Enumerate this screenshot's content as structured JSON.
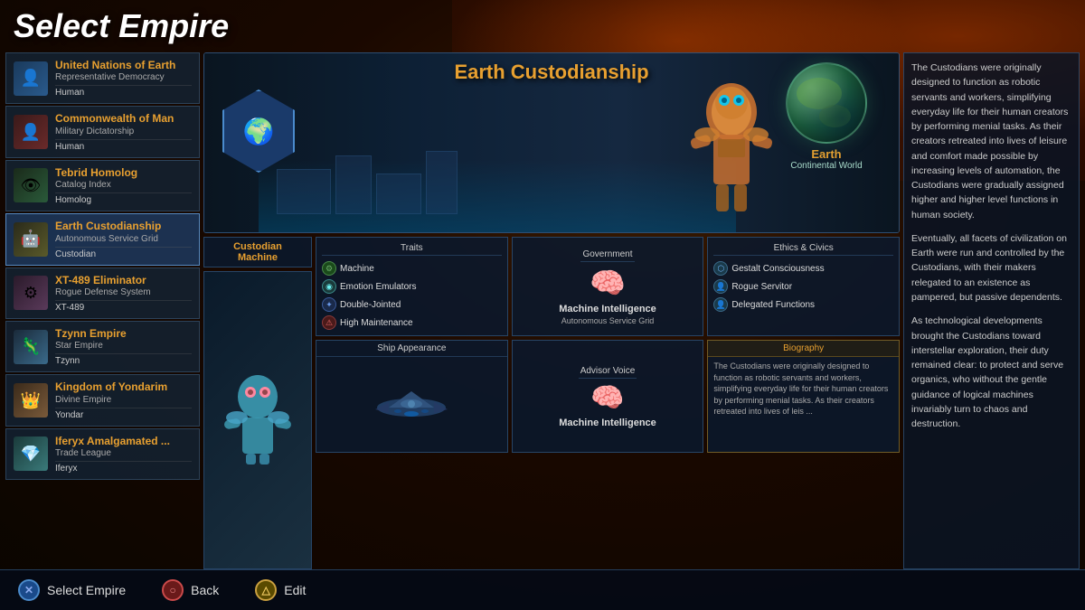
{
  "header": {
    "title": "Select Empire"
  },
  "empires": [
    {
      "id": "ue",
      "name": "United Nations of Earth",
      "government": "Representative Democracy",
      "species": "Human",
      "avatar": "👤",
      "avatarClass": "avatar-ue",
      "selected": false
    },
    {
      "id": "cm",
      "name": "Commonwealth of Man",
      "government": "Military Dictatorship",
      "species": "Human",
      "avatar": "👤",
      "avatarClass": "avatar-cm",
      "selected": false
    },
    {
      "id": "th",
      "name": "Tebrid Homolog",
      "government": "Catalog Index",
      "species": "Homolog",
      "avatar": "👁",
      "avatarClass": "avatar-th",
      "selected": false
    },
    {
      "id": "ec",
      "name": "Earth Custodianship",
      "government": "Autonomous Service Grid",
      "species": "Custodian",
      "avatar": "🤖",
      "avatarClass": "avatar-ec",
      "selected": true
    },
    {
      "id": "xt",
      "name": "XT-489 Eliminator",
      "government": "Rogue Defense System",
      "species": "XT-489",
      "avatar": "⚙",
      "avatarClass": "avatar-xt",
      "selected": false
    },
    {
      "id": "tz",
      "name": "Tzynn Empire",
      "government": "Star Empire",
      "species": "Tzynn",
      "avatar": "🦎",
      "avatarClass": "avatar-tz",
      "selected": false
    },
    {
      "id": "ky",
      "name": "Kingdom of Yondarim",
      "government": "Divine Empire",
      "species": "Yondar",
      "avatar": "👑",
      "avatarClass": "avatar-ky",
      "selected": false
    },
    {
      "id": "ia",
      "name": "Iferyx Amalgamated ...",
      "government": "Trade League",
      "species": "Iferyx",
      "avatar": "💎",
      "avatarClass": "avatar-ia",
      "selected": false
    }
  ],
  "selected_empire": {
    "name": "Earth Custodianship",
    "planet": {
      "name": "Earth",
      "type": "Continental World"
    },
    "portrait_label_line1": "Custodian",
    "portrait_label_line2": "Machine",
    "traits_header": "Traits",
    "traits": [
      {
        "name": "Machine",
        "iconClass": "green",
        "icon": "⚙"
      },
      {
        "name": "Emotion Emulators",
        "iconClass": "teal",
        "icon": "◉"
      },
      {
        "name": "Double-Jointed",
        "iconClass": "blue",
        "icon": "✦"
      },
      {
        "name": "High Maintenance",
        "iconClass": "red",
        "icon": "⚠"
      }
    ],
    "government_header": "Government",
    "government": {
      "name": "Machine Intelligence",
      "sub": "Autonomous Service Grid",
      "icon": "🧠"
    },
    "ethics_header": "Ethics & Civics",
    "ethics": [
      {
        "name": "Gestalt Consciousness",
        "icon": "⬡"
      },
      {
        "name": "Rogue Servitor",
        "icon": "👤"
      },
      {
        "name": "Delegated Functions",
        "icon": "👤"
      }
    ],
    "ship_header": "Ship Appearance",
    "advisor_header": "Advisor Voice",
    "advisor": {
      "name": "Machine Intelligence",
      "icon": "🧠"
    },
    "biography_header": "Biography",
    "biography_preview": "The Custodians were originally designed to function as robotic servants and workers, simplifying everyday life for their human creators by performing menial tasks. As their creators retreated into lives of leis ..."
  },
  "right_panel": {
    "paragraphs": [
      "The Custodians were originally designed to function as robotic servants and workers, simplifying everyday life for their human creators by performing menial tasks. As their creators retreated into lives of leisure and comfort made possible by increasing levels of automation, the Custodians were gradually assigned higher and higher level functions in human society.",
      "Eventually, all facets of civilization on Earth were run and controlled by the Custodians, with their makers relegated to an existence as pampered, but passive dependents.",
      "As technological developments brought the Custodians toward interstellar exploration, their duty remained clear: to protect and serve organics, who without the gentle guidance of logical machines invariably turn to chaos and destruction."
    ]
  },
  "bottom_bar": {
    "select_label": "Select Empire",
    "back_label": "Back",
    "edit_label": "Edit",
    "select_icon": "✕",
    "back_icon": "○",
    "edit_icon": "△"
  }
}
